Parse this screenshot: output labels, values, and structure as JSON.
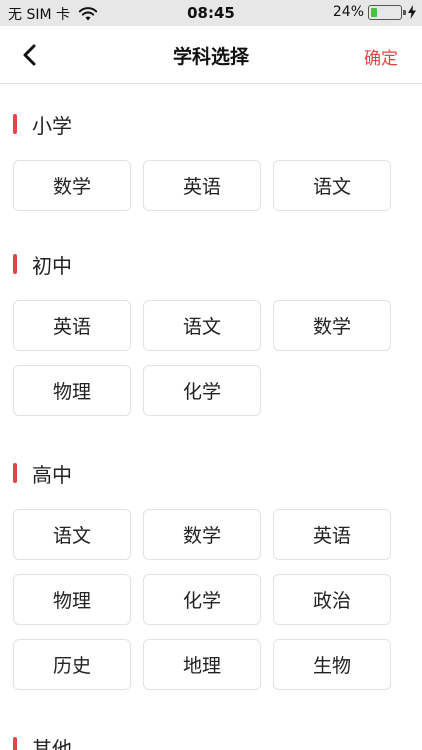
{
  "status_bar": {
    "carrier": "无 SIM 卡",
    "time": "08:45",
    "battery_percent": "24%",
    "battery_level": 0.24,
    "icons": [
      "wifi-icon",
      "battery-icon",
      "charging-bolt-icon"
    ]
  },
  "nav": {
    "back_icon": "chevron-left-icon",
    "title": "学科选择",
    "confirm_label": "确定"
  },
  "colors": {
    "accent": "#e64545",
    "chip_border": "#e2e2e2",
    "status_bar_bg": "#e7e7e7"
  },
  "sections": [
    {
      "title": "小学",
      "subjects": [
        "数学",
        "英语",
        "语文"
      ]
    },
    {
      "title": "初中",
      "subjects": [
        "英语",
        "语文",
        "数学",
        "物理",
        "化学"
      ]
    },
    {
      "title": "高中",
      "subjects": [
        "语文",
        "数学",
        "英语",
        "物理",
        "化学",
        "政治",
        "历史",
        "地理",
        "生物"
      ]
    },
    {
      "title": "其他",
      "subjects": []
    }
  ]
}
